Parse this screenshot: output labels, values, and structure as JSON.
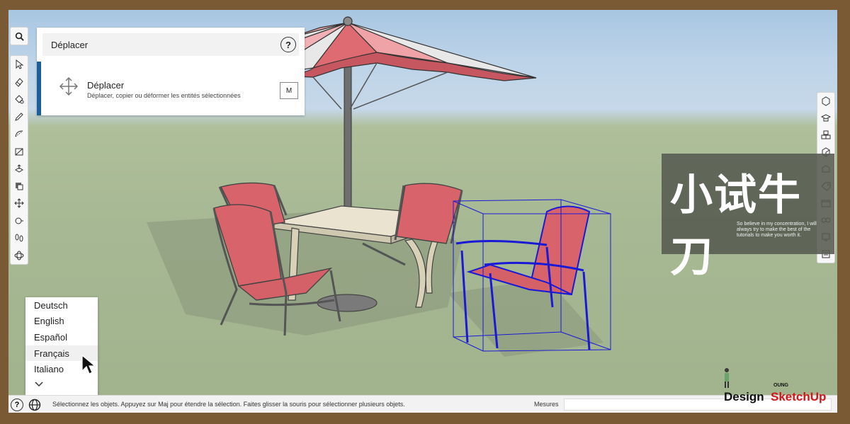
{
  "instructor": {
    "title": "Déplacer",
    "help_label": "?",
    "tool_name": "Déplacer",
    "tool_description": "Déplacer, copier ou déformer les entités sélectionnées",
    "shortcut": "M",
    "accent_color": "#1a5f9c"
  },
  "caption": {
    "title": "小试牛刀",
    "subtitle": "So believe in my concentration, I will always try to make the best of the tutorials to make you worth it."
  },
  "language_menu": {
    "items": [
      "Deutsch",
      "English",
      "Español",
      "Français",
      "Italiano"
    ],
    "selected": "Français",
    "more_icon": "chevron-down-icon"
  },
  "status_bar": {
    "help_label": "?",
    "message": "Sélectionnez les objets. Appuyez sur Maj pour étendre la sélection. Faites glisser la souris pour sélectionner plusieurs objets.",
    "measures_label": "Mesures",
    "measures_value": ""
  },
  "left_toolbar": {
    "icons": [
      "search-icon",
      "select-icon",
      "eraser-icon",
      "paint-bucket-icon",
      "pencil-icon",
      "arc-icon",
      "rectangle-icon",
      "push-pull-icon",
      "offset-icon",
      "move-icon",
      "tape-measure-icon",
      "walk-icon",
      "orbit-icon"
    ]
  },
  "right_toolbar": {
    "icons": [
      "entity-info-icon",
      "instructor-icon",
      "components-icon",
      "materials-icon",
      "styles-icon",
      "tags-icon",
      "scenes-icon",
      "shadows-icon",
      "display-icon",
      "outliner-icon"
    ]
  },
  "watermark": {
    "small": "OUNG",
    "design": "Design",
    "sketchup": "SketchUp"
  },
  "colors": {
    "sky": "#bcd3e8",
    "ground": "#a7b994",
    "fabric": "#d9636b",
    "selection": "#1a1ad6"
  }
}
